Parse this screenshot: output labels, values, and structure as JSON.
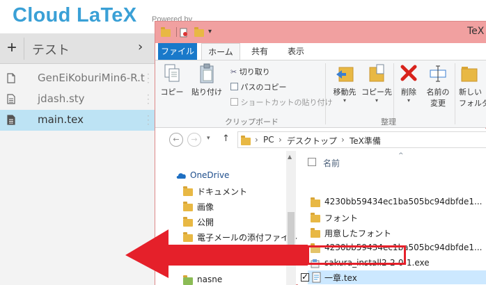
{
  "cloudlatex": {
    "logo": "Cloud LaTeX",
    "powered_by": "Powered by",
    "plus_label": "+",
    "project_name": "テスト",
    "chevron": "›",
    "files": [
      {
        "name": "GenEiKoburiMin6-R.t",
        "icon": "file-icon"
      },
      {
        "name": "jdash.sty",
        "icon": "file-text-icon"
      },
      {
        "name": "main.tex",
        "icon": "file-text-icon"
      }
    ],
    "accent_color": "#3aa0d6",
    "selected_color": "#bde3f4"
  },
  "explorer": {
    "title": "TeX",
    "tabs": [
      "ファイル",
      "ホーム",
      "共有",
      "表示"
    ],
    "ribbon": {
      "copy": "コピー",
      "paste": "貼り付け",
      "cut": "切り取り",
      "copy_path": "パスのコピー",
      "paste_shortcut": "ショートカットの貼り付け",
      "clipboard_group": "クリップボード",
      "move_to": "移動先",
      "copy_to": "コピー先",
      "delete": "削除",
      "rename_line1": "名前の",
      "rename_line2": "変更",
      "new_line1": "新しい",
      "new_line2": "フォルダー",
      "organize_group": "整理"
    },
    "address": [
      "PC",
      "デスクトップ",
      "TeX準備"
    ],
    "nav_back": "←",
    "nav_forward": "→",
    "nav_up": "↑",
    "nav_items": [
      "OneDrive",
      "ドキュメント",
      "画像",
      "公開",
      "電子メールの添付ファイル",
      "nasne"
    ],
    "column_header": "名前",
    "files": [
      {
        "name": "4230bb59434ec1ba505bc94dbfde1...",
        "icon": "folder-icon"
      },
      {
        "name": "フォント",
        "icon": "folder-icon"
      },
      {
        "name": "用意したフォント",
        "icon": "folder-icon"
      },
      {
        "name": "4230bb59434ec1ba505bc94dbfde1...",
        "icon": "zip-folder-icon"
      },
      {
        "name": "sakura_install2-2-0-1.exe",
        "icon": "installer-icon"
      },
      {
        "name": "一章.tex",
        "icon": "tex-file-icon",
        "selected": true
      }
    ],
    "title_color": "#f1a0a0",
    "file_tab_color": "#1979ca"
  },
  "annotation": {
    "highlight_color": "#e5202a",
    "arrow_direction": "left"
  }
}
